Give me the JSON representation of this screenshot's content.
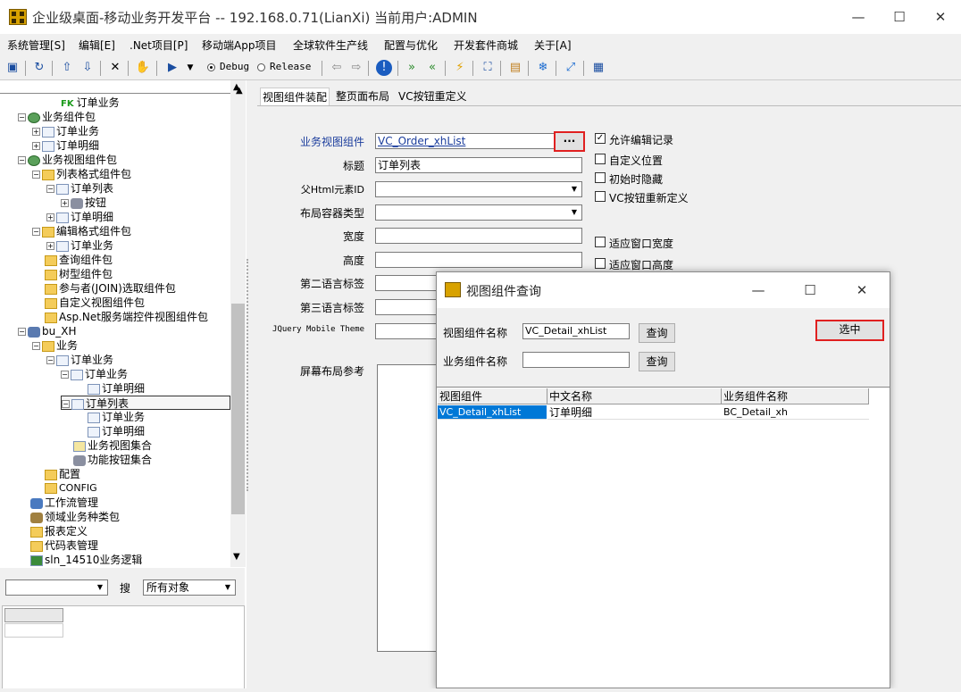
{
  "window": {
    "title": "企业级桌面-移动业务开发平台 -- 192.168.0.71(LianXi) 当前用户:ADMIN",
    "min_label": "—",
    "max_label": "☐",
    "close_label": "✕"
  },
  "menu": [
    "系统管理[S]",
    "编辑[E]",
    ".Net项目[P]",
    "移动端App项目",
    "全球软件生产线",
    "配置与优化",
    "开发套件商城",
    "关于[A]"
  ],
  "toolbar": {
    "debug_label": "Debug",
    "release_label": "Release",
    "debug_selected": true
  },
  "tree": {
    "nodes": [
      {
        "label": "订单业务",
        "prefix": "FK"
      },
      {
        "label": "业务组件包"
      },
      {
        "label": "订单业务"
      },
      {
        "label": "订单明细"
      },
      {
        "label": "业务视图组件包"
      },
      {
        "label": "列表格式组件包"
      },
      {
        "label": "订单列表"
      },
      {
        "label": "按钮"
      },
      {
        "label": "订单明细"
      },
      {
        "label": "编辑格式组件包"
      },
      {
        "label": "订单业务"
      },
      {
        "label": "查询组件包"
      },
      {
        "label": "树型组件包"
      },
      {
        "label": "参与者(JOIN)选取组件包"
      },
      {
        "label": "自定义视图组件包"
      },
      {
        "label": "Asp.Net服务端控件视图组件包"
      },
      {
        "label": "bu_XH"
      },
      {
        "label": "业务"
      },
      {
        "label": "订单业务"
      },
      {
        "label": "订单业务"
      },
      {
        "label": "订单明细"
      },
      {
        "label": "订单列表"
      },
      {
        "label": "订单业务"
      },
      {
        "label": "订单明细"
      },
      {
        "label": "业务视图集合"
      },
      {
        "label": "功能按钮集合"
      },
      {
        "label": "配置"
      },
      {
        "label": "CONFIG"
      },
      {
        "label": "工作流管理"
      },
      {
        "label": "领域业务种类包"
      },
      {
        "label": "报表定义"
      },
      {
        "label": "代码表管理"
      },
      {
        "label": "sln_14510业务逻辑"
      }
    ]
  },
  "search_bar": {
    "search_label": "搜",
    "object_filter": "所有对象"
  },
  "tabs": [
    "视图组件装配",
    "整页面布局",
    "VC按钮重定义"
  ],
  "form": {
    "view_component_label": "业务视图组件",
    "view_component_value": "VC_Order_xhList",
    "browse_label": "···",
    "title_label": "标题",
    "title_value": "订单列表",
    "parent_html_label": "父Html元素ID",
    "layout_container_label": "布局容器类型",
    "width_label": "宽度",
    "height_label": "高度",
    "second_lang_label": "第二语言标签",
    "third_lang_label": "第三语言标签",
    "jquery_theme_label": "JQuery Mobile Theme",
    "screen_layout_label": "屏幕布局参考"
  },
  "checkboxes": [
    {
      "label": "允许编辑记录",
      "checked": true
    },
    {
      "label": "自定义位置",
      "checked": false
    },
    {
      "label": "初始时隐藏",
      "checked": false
    },
    {
      "label": "VC按钮重新定义",
      "checked": false
    },
    {
      "label": "适应窗口宽度",
      "checked": false
    },
    {
      "label": "适应窗口高度",
      "checked": false
    }
  ],
  "dialog": {
    "title": "视图组件查询",
    "min_label": "—",
    "max_label": "☐",
    "close_label": "✕",
    "vc_name_label": "视图组件名称",
    "vc_name_value": "VC_Detail_xhList",
    "query_button": "查询",
    "bc_name_label": "业务组件名称",
    "bc_name_value": "",
    "query_button_2": "查询",
    "select_button": "选中",
    "grid": {
      "columns": [
        "视图组件",
        "中文名称",
        "业务组件名称"
      ],
      "rows": [
        [
          "VC_Detail_xhList",
          "订单明细",
          "BC_Detail_xh"
        ]
      ]
    }
  },
  "colors": {
    "highlight_box": "#e02020",
    "selection_blue": "#0078d7",
    "link_blue": "#1a3c9c"
  }
}
